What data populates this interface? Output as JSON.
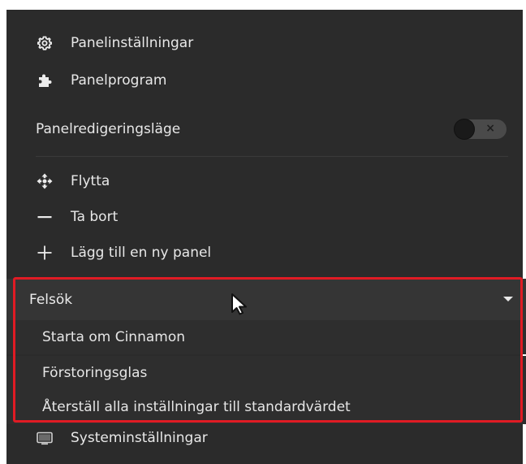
{
  "menu": {
    "items_top": [
      {
        "label": "Panelinställningar",
        "icon": "gear-icon"
      },
      {
        "label": "Panelprogram",
        "icon": "puzzle-icon"
      }
    ],
    "edit_mode": {
      "label": "Panelredigeringsläge",
      "toggle_state": "off"
    },
    "items_edit": [
      {
        "label": "Flytta",
        "icon": "move-icon"
      },
      {
        "label": "Ta bort",
        "icon": "minus-icon"
      },
      {
        "label": "Lägg till en ny panel",
        "icon": "plus-icon"
      }
    ],
    "troubleshoot": {
      "label": "Felsök",
      "expanded": true,
      "items": [
        {
          "label": "Starta om Cinnamon"
        },
        {
          "label": "Förstoringsglas"
        },
        {
          "label": "Återställ alla inställningar till standardvärdet"
        }
      ]
    },
    "system_settings": {
      "label": "Systeminställningar",
      "icon": "display-icon"
    }
  },
  "colors": {
    "menu_background": "#2b2b2b",
    "highlight_border": "#e01b24",
    "text": "#e8e8e8"
  }
}
